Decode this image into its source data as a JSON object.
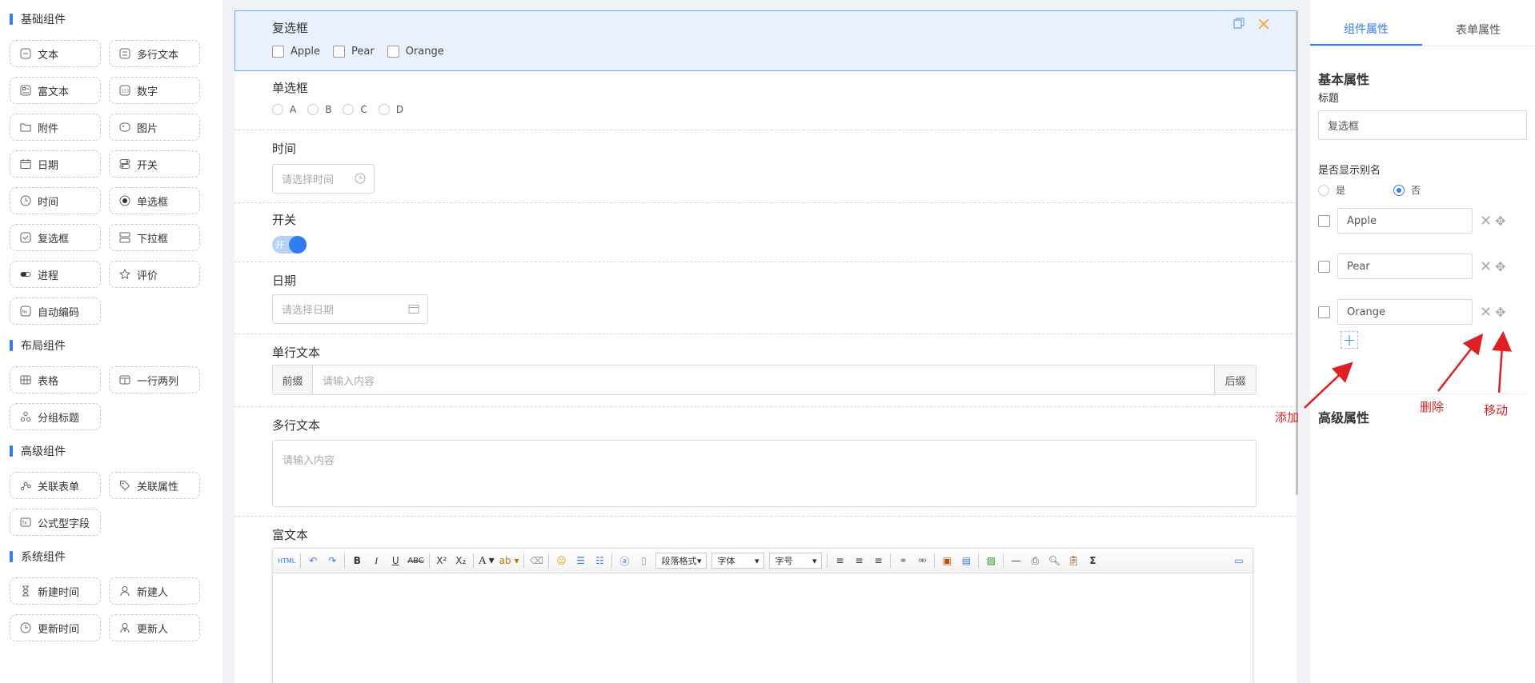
{
  "left_panel": {
    "groups": [
      {
        "title": "基础组件",
        "items": [
          {
            "label": "文本",
            "icon": "text-icon"
          },
          {
            "label": "多行文本",
            "icon": "multiline-text-icon"
          },
          {
            "label": "富文本",
            "icon": "rich-text-icon"
          },
          {
            "label": "数字",
            "icon": "number-icon"
          },
          {
            "label": "附件",
            "icon": "folder-icon"
          },
          {
            "label": "图片",
            "icon": "image-icon"
          },
          {
            "label": "日期",
            "icon": "calendar-icon"
          },
          {
            "label": "开关",
            "icon": "switch-icon"
          },
          {
            "label": "时间",
            "icon": "clock-icon"
          },
          {
            "label": "单选框",
            "icon": "radio-icon"
          },
          {
            "label": "复选框",
            "icon": "checkbox-icon"
          },
          {
            "label": "下拉框",
            "icon": "dropdown-icon"
          },
          {
            "label": "进程",
            "icon": "progress-icon"
          },
          {
            "label": "评价",
            "icon": "star-icon"
          },
          {
            "label": "自动编码",
            "icon": "auto-code-icon"
          }
        ]
      },
      {
        "title": "布局组件",
        "items": [
          {
            "label": "表格",
            "icon": "table-icon"
          },
          {
            "label": "一行两列",
            "icon": "two-column-icon"
          },
          {
            "label": "分组标题",
            "icon": "group-title-icon"
          }
        ]
      },
      {
        "title": "高级组件",
        "items": [
          {
            "label": "关联表单",
            "icon": "link-form-icon"
          },
          {
            "label": "关联属性",
            "icon": "tag-icon"
          },
          {
            "label": "公式型字段",
            "icon": "formula-icon"
          }
        ]
      },
      {
        "title": "系统组件",
        "items": [
          {
            "label": "新建时间",
            "icon": "hourglass-icon"
          },
          {
            "label": "新建人",
            "icon": "user-icon"
          },
          {
            "label": "更新时间",
            "icon": "update-time-icon"
          },
          {
            "label": "更新人",
            "icon": "update-user-icon"
          }
        ]
      }
    ]
  },
  "canvas": {
    "checkbox_field": {
      "label": "复选框",
      "options": [
        "Apple",
        "Pear",
        "Orange"
      ]
    },
    "radio_field": {
      "label": "单选框",
      "options": [
        "A",
        "B",
        "C",
        "D"
      ]
    },
    "time_field": {
      "label": "时间",
      "placeholder": "请选择时间"
    },
    "switch_field": {
      "label": "开关",
      "on_text": "开"
    },
    "date_field": {
      "label": "日期",
      "placeholder": "请选择日期"
    },
    "single_text_field": {
      "label": "单行文本",
      "prefix": "前缀",
      "placeholder": "请输入内容",
      "suffix": "后缀"
    },
    "multi_text_field": {
      "label": "多行文本",
      "placeholder": "请输入内容"
    },
    "rich_text_field": {
      "label": "富文本",
      "toolbar": {
        "paragraph": "段落格式",
        "font": "字体",
        "size": "字号"
      }
    }
  },
  "right_panel": {
    "tabs": [
      "组件属性",
      "表单属性"
    ],
    "active_tab": 0,
    "basic_title": "基本属性",
    "title_label": "标题",
    "title_value": "复选框",
    "alias_label": "是否显示别名",
    "alias_yes": "是",
    "alias_no": "否",
    "alias_selected": "否",
    "options": [
      "Apple",
      "Pear",
      "Orange"
    ],
    "advanced_title": "高级属性"
  },
  "annotations": {
    "add": "添加",
    "delete": "删除",
    "move": "移动"
  },
  "colors": {
    "accent": "#2f7cf6",
    "annotation": "#e02020",
    "close": "#f5a623"
  }
}
